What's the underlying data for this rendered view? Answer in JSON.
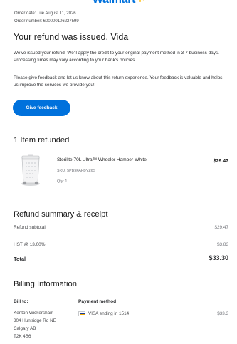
{
  "header": {
    "logo_text": "Walmart",
    "order_date": "Order date: Tue August 11, 2026",
    "order_number": "Order number: 600000106227599"
  },
  "main": {
    "headline": "Your refund was issued, Vida",
    "paragraph_1": "We've issued your refund. We'll apply the credit to your original payment method in 3-7 business days. Processing times may vary according to your bank's policies.",
    "paragraph_2": "Please give feedback and let us know about this return experience. Your feedback is valuable and helps us improve the services we provide you!",
    "feedback_button": "Give feedback"
  },
  "items": {
    "title": "1 Item refunded",
    "list": [
      {
        "name": "Sterilite 70L Ultra™ Wheeler Hamper-White",
        "price": "$29.47",
        "sku": "SKU: 5PB9FAH9YZ6S",
        "qty": "Qty: 1",
        "icon": "hamper-image"
      }
    ]
  },
  "summary": {
    "title": "Refund summary & receipt",
    "subtotal_label": "Refund subtotal",
    "subtotal_value": "$29.47",
    "tax_label": "HST @ 13.00%",
    "tax_value": "$3.83",
    "total_label": "Total",
    "total_value": "$33.30"
  },
  "billing": {
    "title": "Billing Information",
    "bill_to_label": "Bill to:",
    "address": [
      "Kenton Wickersham",
      "304 Huntridge Rd NE",
      "Calgary AB",
      "T2K 4B6"
    ],
    "payment_label": "Payment method",
    "payment_method": "VISA ending in 1514",
    "payment_amount": "$33.3",
    "card_icon": "visa-card-icon"
  },
  "colors": {
    "brand_blue": "#0071dc",
    "spark_yellow": "#ffc220",
    "text_dark": "#2e2f32",
    "text_muted": "#74767c",
    "divider": "#e6e7e8"
  }
}
